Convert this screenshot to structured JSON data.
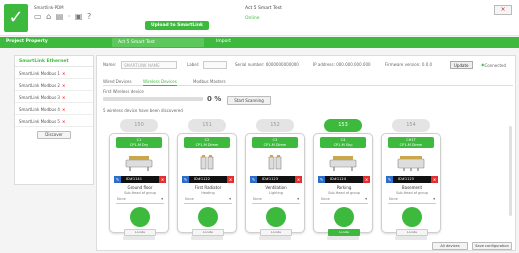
{
  "app": {
    "name": "Smartlink-PDM",
    "upload_link": "Upload to SmartLink"
  },
  "device": {
    "title": "Act 5 Smart Test",
    "status": "Online"
  },
  "window": {
    "close": "×"
  },
  "toolbar_icons": "▭ ⌂ ▤ · ▣ ?",
  "nav": {
    "project": "Project Property",
    "device_tab": "Act 5 Smart Test",
    "import": "Import"
  },
  "sidebar": {
    "header": "SmartLink Ethernet",
    "items": [
      {
        "label": "SmartLink Modbus 1"
      },
      {
        "label": "SmartLink Modbus 2"
      },
      {
        "label": "SmartLink Modbus 3"
      },
      {
        "label": "SmartLink Modbus 4"
      },
      {
        "label": "SmartLink Modbus 5"
      }
    ],
    "discover": "Discover"
  },
  "info": {
    "name_label": "Name:",
    "name_value": "SMARTLINK NAME",
    "label_label": "Label:",
    "serial": "Serial number: 0000000000000",
    "ip": "IP address: 000.000.000.000",
    "firmware": "Firmware version: 0.0.0",
    "update": "Update",
    "connected": "Connected"
  },
  "tabs": {
    "wired": "Wired Devices",
    "wireless": "Wireless Devices",
    "modbus": "Modbus Masters"
  },
  "scan": {
    "found_label": "First Wireless device",
    "percent": "0 %",
    "start": "Start Scanning",
    "discovered": "5 wireless device have been discovered",
    "progress": 0
  },
  "cards": [
    {
      "num": "150",
      "model": "C1",
      "type": "CP1-M Dry",
      "id": "ID#1141",
      "name": "Ground floor",
      "role": "Sub-Head of group",
      "select": "None",
      "locate": "Locate",
      "selected": false
    },
    {
      "num": "151",
      "model": "C2",
      "type": "CP1-M Dimm",
      "id": "ID#1122",
      "name": "First Radiator",
      "role": "Heating",
      "select": "None",
      "locate": "Locate",
      "selected": false
    },
    {
      "num": "152",
      "model": "C3",
      "type": "CP1-M Dimm",
      "id": "ID#1123",
      "name": "Ventilation",
      "role": "Lighting",
      "select": "None",
      "locate": "Locate",
      "selected": false
    },
    {
      "num": "153",
      "model": "C4",
      "type": "CP1-M Shp",
      "id": "ID#1124",
      "name": "Parking",
      "role": "Sub-Head of group",
      "select": "None",
      "locate": "Locate",
      "selected": true
    },
    {
      "num": "154",
      "model": "CH1T",
      "type": "CP1-M Dimm",
      "id": "ID#1125",
      "name": "Basement",
      "role": "Sub-Head of group",
      "select": "None",
      "locate": "Locate",
      "selected": false
    }
  ],
  "bottom": {
    "btn1": "All devices",
    "btn2": "Save configuration"
  }
}
